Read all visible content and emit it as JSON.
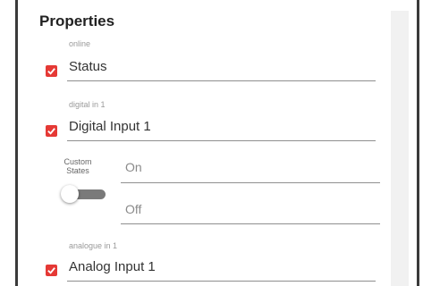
{
  "panel": {
    "title": "Properties"
  },
  "properties": [
    {
      "key": "online",
      "value": "Status",
      "checked": true
    },
    {
      "key": "digital in 1",
      "value": "Digital Input 1",
      "checked": true
    },
    {
      "key": "analogue in 1",
      "value": "Analog Input 1",
      "checked": true
    }
  ],
  "custom_states": {
    "label": "Custom States",
    "toggle_on": false,
    "on_placeholder": "On",
    "off_placeholder": "Off"
  },
  "colors": {
    "checkbox": "#e53935",
    "toggle_track": "#7a7a7a"
  }
}
